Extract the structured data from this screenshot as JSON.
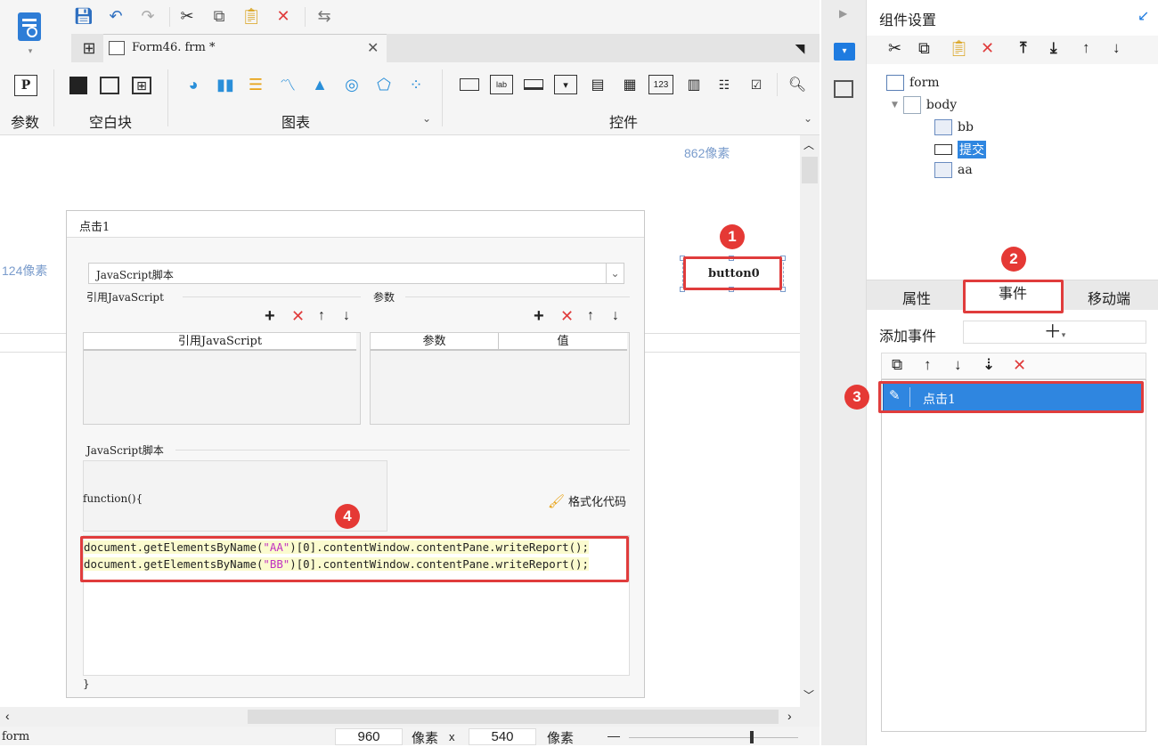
{
  "toolbar": {
    "tab_file": "Form46. frm *",
    "sections": {
      "params": "参数",
      "blank": "空白块",
      "chart": "图表",
      "widgets": "控件"
    }
  },
  "canvas": {
    "ruler_right": "862像素",
    "ruler_left": "124像素",
    "button_label": "button0"
  },
  "dialog": {
    "title": "点击1",
    "script_type": "JavaScript脚本",
    "ref_js_label": "引用JavaScript",
    "params_label": "参数",
    "ref_js_header": "引用JavaScript",
    "param_header": "参数",
    "value_header": "值",
    "script_label": "JavaScript脚本",
    "func_open": "function(){",
    "format_label": "格式化代码",
    "code_line1_a": "document.getElementsByName(",
    "code_line1_s": "\"AA\"",
    "code_line1_b": ")[0].contentWindow.contentPane.writeReport();",
    "code_line2_a": "document.getElementsByName(",
    "code_line2_s": "\"BB\"",
    "code_line2_b": ")[0].contentWindow.contentPane.writeReport();",
    "func_close": "}"
  },
  "status": {
    "name": "form",
    "width": "960",
    "unit1": "像素",
    "x": "x",
    "height": "540",
    "unit2": "像素",
    "minus": "—"
  },
  "right": {
    "title": "组件设置",
    "tree": {
      "form": "form",
      "body": "body",
      "bb": "bb",
      "submit": "提交",
      "aa": "aa"
    },
    "tabs": {
      "attr": "属性",
      "event": "事件",
      "mobile": "移动端"
    },
    "add_event": "添加事件",
    "event_item": "点击1"
  },
  "badges": {
    "b1": "1",
    "b2": "2",
    "b3": "3",
    "b4": "4"
  },
  "colors": {
    "accent": "#1e7be0",
    "red": "#e03c3c",
    "selected": "#2f86e0"
  }
}
